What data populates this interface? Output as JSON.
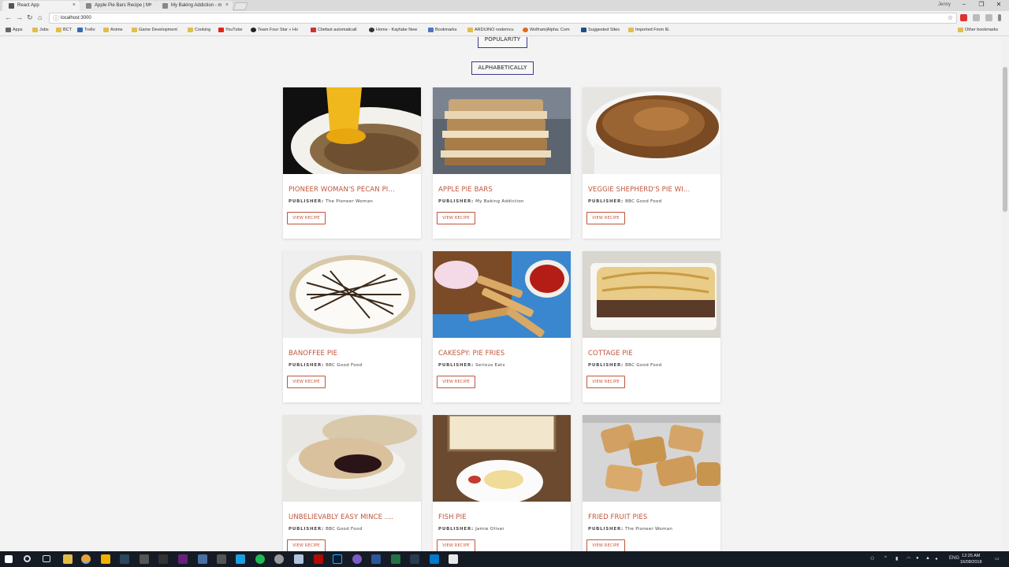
{
  "browser": {
    "tabs": [
      {
        "label": "React App",
        "close": "×"
      },
      {
        "label": "Apple Pie Bars Recipe | M",
        "close": "×"
      },
      {
        "label": "My Baking Addiction - m",
        "close": "×"
      }
    ],
    "profile": "Jenny",
    "window_controls": [
      "−",
      "❐",
      "✕"
    ],
    "url": "localhost:3000",
    "nav": {
      "back": "←",
      "forward": "→",
      "reload": "↻",
      "home": "⌂"
    },
    "bookmarks": [
      "Apps",
      "Jobs",
      "BCT",
      "Trello",
      "Anime",
      "Game Development",
      "Cooking",
      "YouTube",
      "Team Four Star » Ho",
      "Citefast automaticall",
      "Home - Kayfabe New",
      "Bookmarks",
      "ARDUINO nodemcu",
      "Wolfram|Alpha: Com",
      "Suggested Sites",
      "Imported From IE"
    ],
    "other_bookmarks": "Other bookmarks"
  },
  "sort": {
    "popularity": "POPULARITY",
    "alphabetically": "ALPHABETICALLY"
  },
  "publisher_label": "PUBLISHER:",
  "view_label": "VIEW RECIPE",
  "recipes": [
    {
      "title": "PIONEER WOMAN'S PECAN PI...",
      "publisher": "The Pioneer Woman"
    },
    {
      "title": "APPLE PIE BARS",
      "publisher": "My Baking Addiction"
    },
    {
      "title": "VEGGIE SHEPHERD'S PIE WI...",
      "publisher": "BBC Good Food"
    },
    {
      "title": "BANOFFEE PIE",
      "publisher": "BBC Good Food"
    },
    {
      "title": "CAKESPY: PIE FRIES",
      "publisher": "Serious Eats"
    },
    {
      "title": "COTTAGE PIE",
      "publisher": "BBC Good Food"
    },
    {
      "title": "UNBELIEVABLY EASY MINCE ....",
      "publisher": "BBC Good Food"
    },
    {
      "title": "FISH PIE",
      "publisher": "Jamie Oliver"
    },
    {
      "title": "FRIED FRUIT PIES",
      "publisher": "The Pioneer Woman"
    }
  ],
  "taskbar": {
    "tray_lang": "ENG",
    "time": "12:25 AM",
    "date": "16/08/2018"
  },
  "colors": {
    "accent": "#c0553b",
    "sort_border": "#3a3a8c",
    "taskbar": "#151b25"
  }
}
